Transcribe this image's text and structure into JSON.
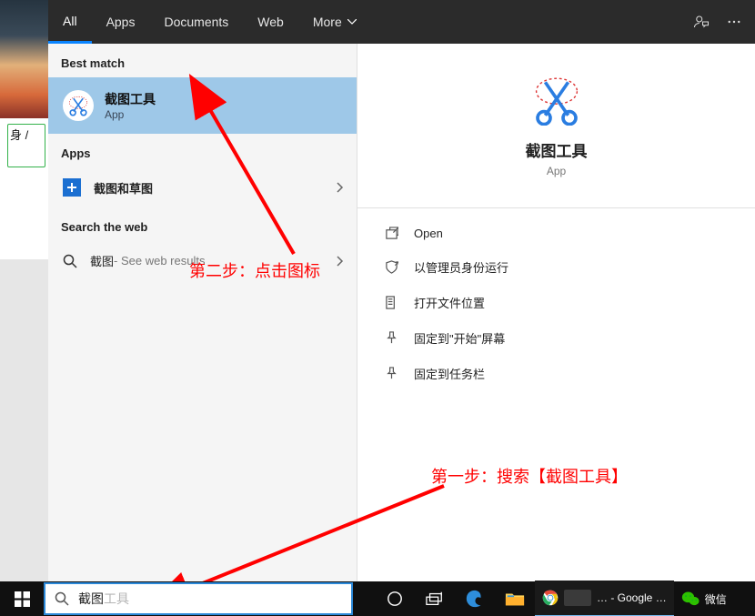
{
  "header": {
    "tabs": {
      "all": "All",
      "apps": "Apps",
      "documents": "Documents",
      "web": "Web",
      "more": "More"
    }
  },
  "left": {
    "best_match_hdr": "Best match",
    "best_match": {
      "title": "截图工具",
      "sub": "App"
    },
    "apps_hdr": "Apps",
    "app1": "截图和草图",
    "search_web_hdr": "Search the web",
    "web_query": "截图",
    "web_suffix": " - See web results"
  },
  "preview": {
    "title": "截图工具",
    "sub": "App"
  },
  "actions": {
    "open": "Open",
    "run_admin": "以管理员身份运行",
    "open_loc": "打开文件位置",
    "pin_start": "固定到\"开始\"屏幕",
    "pin_taskbar": "固定到任务栏"
  },
  "annotations": {
    "step2": "第二步：点击图标",
    "step1": "第一步：搜索【截图工具】"
  },
  "search": {
    "value": "截图",
    "ghost": "工具"
  },
  "taskbar": {
    "chrome_label": "… - Google …",
    "wechat_label": "微信"
  },
  "desktop_card": "身 /"
}
